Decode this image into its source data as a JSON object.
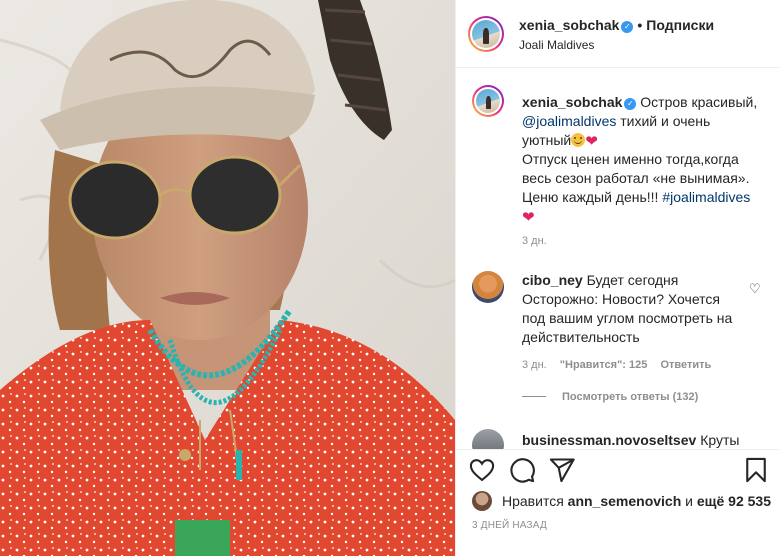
{
  "header": {
    "username": "xenia_sobchak",
    "separator": "•",
    "follow_label": "Подписки",
    "location": "Joali Maldives"
  },
  "caption": {
    "username": "xenia_sobchak",
    "line1": "Остров красивый,",
    "mention": "@joalimaldives",
    "line2": "тихий и очень уютный",
    "line3": "Отпуск ценен именно тогда,когда весь сезон работал «не вынимая». Ценю каждый день!!!",
    "hashtag": "#joalimaldives",
    "time": "3 дн."
  },
  "comments": [
    {
      "username": "cibo_ney",
      "text": "Будет сегодня Осторожно: Новости? Хочется под вашим углом посмотреть на действительность",
      "time": "3 дн.",
      "likes": "\"Нравится\": 125",
      "reply_label": "Ответить",
      "view_replies": "Посмотреть ответы (132)"
    },
    {
      "username": "businessman.novoseltsev",
      "text": "Круты"
    }
  ],
  "likes": {
    "prefix": "Нравится",
    "user": "ann_semenovich",
    "middle": "и",
    "count": "ещё 92 535"
  },
  "timestamp": "3 ДНЕЙ НАЗАД",
  "icons": [
    "verified-icon",
    "heart-icon",
    "comment-icon",
    "share-icon",
    "bookmark-icon"
  ],
  "colors": {
    "verified": "#3897f0",
    "link": "#00376b",
    "muted": "#8e8e8e",
    "dress": "#e2472f"
  }
}
